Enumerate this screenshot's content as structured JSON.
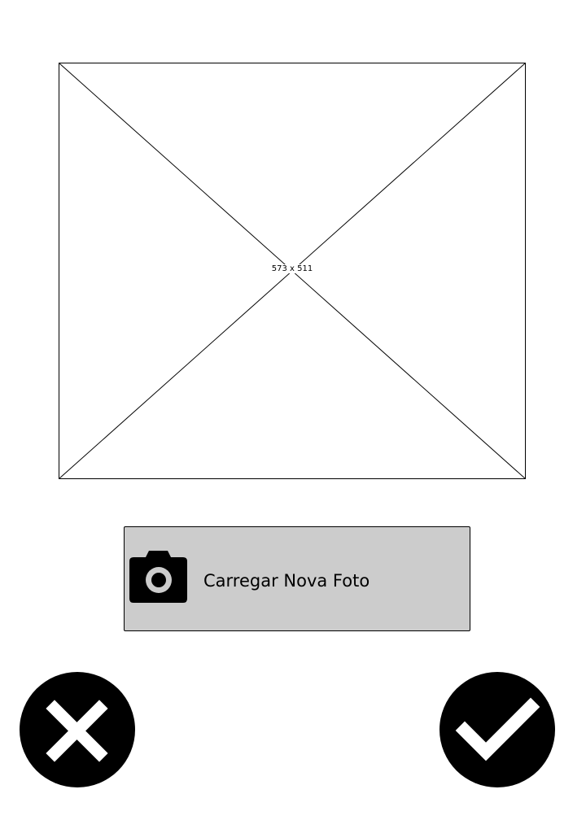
{
  "image_placeholder": {
    "dimensions_label": "573 x 511"
  },
  "upload": {
    "label": "Carregar Nova Foto",
    "icon": "camera-icon"
  },
  "actions": {
    "cancel_icon": "close-icon",
    "confirm_icon": "check-icon"
  },
  "colors": {
    "background": "#ffffff",
    "button_fill": "#cccccc",
    "icon_fill": "#000000"
  }
}
